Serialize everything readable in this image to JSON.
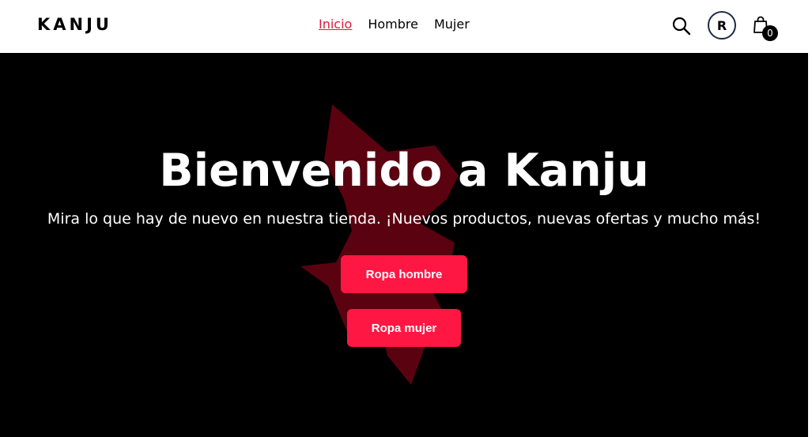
{
  "header": {
    "logo": "KANJU",
    "nav": [
      {
        "label": "Inicio",
        "active": true
      },
      {
        "label": "Hombre",
        "active": false
      },
      {
        "label": "Mujer",
        "active": false
      }
    ],
    "avatar_initial": "R",
    "cart_count": "0"
  },
  "hero": {
    "title": "Bienvenido a Kanju",
    "subtitle": "Mira lo que hay de nuevo en nuestra tienda. ¡Nuevos productos, nuevas ofertas y mucho más!",
    "buttons": {
      "men": "Ropa hombre",
      "women": "Ropa mujer"
    }
  },
  "colors": {
    "accent": "#ff1744",
    "active_link": "#e5173f",
    "hero_bg": "#000000",
    "wolf_shape": "#5a0210"
  },
  "icons": {
    "search": "search-icon",
    "cart": "shopping-bag-icon"
  }
}
